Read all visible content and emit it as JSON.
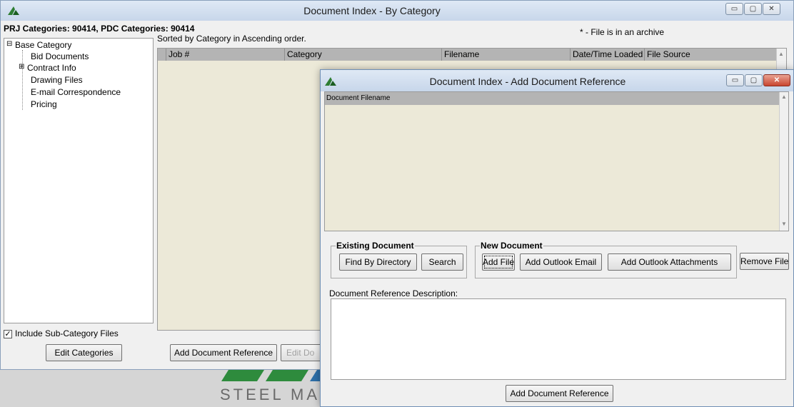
{
  "main_window": {
    "title": "Document Index - By Category",
    "header_text": "PRJ Categories: 90414, PDC Categories: 90414",
    "archive_note": "* - File is in an archive",
    "sort_text": "Sorted by Category in Ascending order.",
    "tree": {
      "root": "Base Category",
      "items": [
        "Bid Documents",
        "Contract Info",
        "Drawing Files",
        "E-mail Correspondence",
        "Pricing"
      ]
    },
    "columns": [
      "Job #",
      "Category",
      "Filename",
      "Date/Time Loaded",
      "File Source"
    ],
    "include_subcategory_label": "Include Sub-Category Files",
    "include_subcategory_checked": true,
    "edit_categories_label": "Edit Categories",
    "add_document_reference_label": "Add Document Reference",
    "edit_doc_label": "Edit Do",
    "logo_text": "STEEL MA"
  },
  "dialog": {
    "title": "Document Index - Add Document Reference",
    "list_header": "Document Filename",
    "existing_group_label": "Existing Document",
    "find_by_directory_label": "Find By Directory",
    "search_label": "Search",
    "new_group_label": "New Document",
    "add_file_label": "Add File",
    "add_outlook_email_label": "Add Outlook Email",
    "add_outlook_attachments_label": "Add Outlook Attachments",
    "remove_file_label": "Remove File",
    "description_label": "Document Reference Description:",
    "description_value": "",
    "add_document_reference_label": "Add Document Reference"
  },
  "colors": {
    "panel": "#f0f0f0",
    "list_bg": "#ece9d8",
    "header_bg": "#b4b4b4",
    "logo_green": "#2e8b3d",
    "close_red": "#c9452f"
  }
}
